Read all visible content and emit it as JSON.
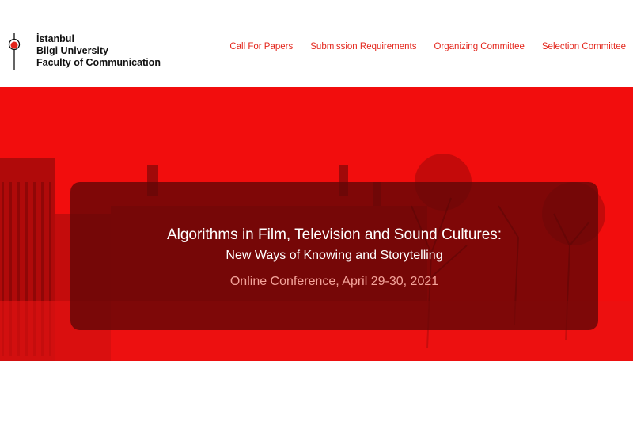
{
  "logo": {
    "line1": "İstanbul",
    "line2": "Bilgi University",
    "line3": "Faculty of Communication",
    "icon": "bilgi-logo-icon"
  },
  "nav": {
    "items": [
      {
        "label": "Call For Papers"
      },
      {
        "label": "Submission Requirements"
      },
      {
        "label": "Organizing Committee"
      },
      {
        "label": "Selection Committee"
      }
    ]
  },
  "hero": {
    "title": "Algorithms in Film, Television and Sound Cultures:",
    "subtitle": "New Ways of Knowing and Storytelling",
    "event": "Online Conference, April 29-30, 2021"
  },
  "colors": {
    "accent": "#e3251b",
    "hero_bg": "#f20d0d",
    "overlay": "#5f0606",
    "event_text": "#f4a39a"
  }
}
